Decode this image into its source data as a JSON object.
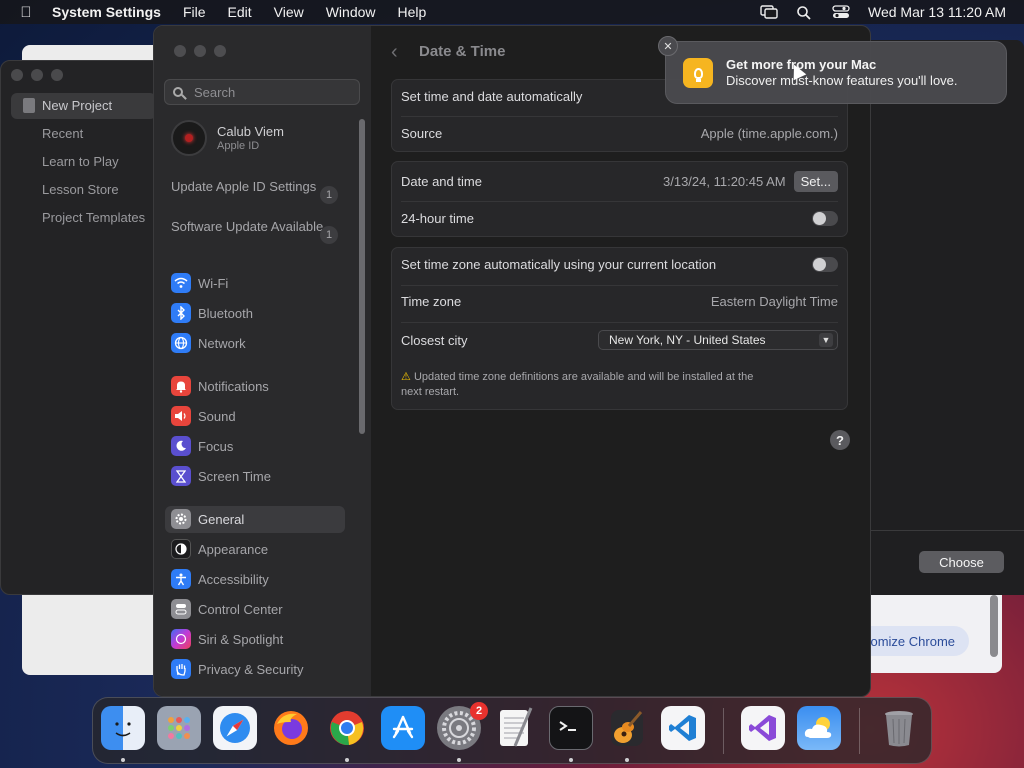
{
  "menubar": {
    "app_name": "System Settings",
    "menus": [
      "File",
      "Edit",
      "View",
      "Window",
      "Help"
    ],
    "clock": "Wed Mar 13  11:20 AM"
  },
  "background_window": {
    "items": [
      "New Project",
      "Recent",
      "Learn to Play",
      "Lesson Store",
      "Project Templates"
    ],
    "choose_label": "Choose",
    "chrome_pill": "tomize Chrome"
  },
  "sidebar": {
    "search_placeholder": "Search",
    "account": {
      "name": "Calub Viem",
      "sub": "Apple ID"
    },
    "updates": [
      {
        "label": "Update Apple ID Settings",
        "count": "1"
      },
      {
        "label": "Software Update Available",
        "count": "1"
      }
    ],
    "items": [
      {
        "label": "Wi-Fi",
        "icon": "wifi-icon",
        "color": "#2f7cf6"
      },
      {
        "label": "Bluetooth",
        "icon": "bluetooth-icon",
        "color": "#2f7cf6"
      },
      {
        "label": "Network",
        "icon": "globe-icon",
        "color": "#2f7cf6"
      },
      {
        "label": "Notifications",
        "icon": "bell-icon",
        "color": "#e8453c"
      },
      {
        "label": "Sound",
        "icon": "speaker-icon",
        "color": "#e8453c"
      },
      {
        "label": "Focus",
        "icon": "moon-icon",
        "color": "#5a4fcf"
      },
      {
        "label": "Screen Time",
        "icon": "hourglass-icon",
        "color": "#5a4fcf"
      },
      {
        "label": "General",
        "icon": "gear-icon",
        "color": "#8e8e93"
      },
      {
        "label": "Appearance",
        "icon": "appearance-icon",
        "color": "#1c1c1e"
      },
      {
        "label": "Accessibility",
        "icon": "accessibility-icon",
        "color": "#2f7cf6"
      },
      {
        "label": "Control Center",
        "icon": "control-center-icon",
        "color": "#8e8e93"
      },
      {
        "label": "Siri & Spotlight",
        "icon": "siri-icon",
        "color": "#b04ad8"
      },
      {
        "label": "Privacy & Security",
        "icon": "hand-icon",
        "color": "#2f7cf6"
      }
    ],
    "selected": "General"
  },
  "content": {
    "title": "Date & Time",
    "group1": {
      "auto_label": "Set time and date automatically",
      "source_label": "Source",
      "source_value": "Apple (time.apple.com.)"
    },
    "group2": {
      "date_label": "Date and time",
      "date_value": "3/13/24, 11:20:45 AM",
      "set_button": "Set...",
      "hour_label": "24-hour time"
    },
    "group3": {
      "tz_auto_label": "Set time zone automatically using your current location",
      "tz_label": "Time zone",
      "tz_value": "Eastern Daylight Time",
      "city_label": "Closest city",
      "city_value": "New York, NY - United States",
      "note_line1": "Updated time zone definitions are available and will be installed at the",
      "note_line2": "next restart."
    },
    "help": "?"
  },
  "notification": {
    "title": "Get more from your Mac",
    "body": "Discover must-know features you'll love."
  },
  "dock": {
    "badge": "2"
  }
}
